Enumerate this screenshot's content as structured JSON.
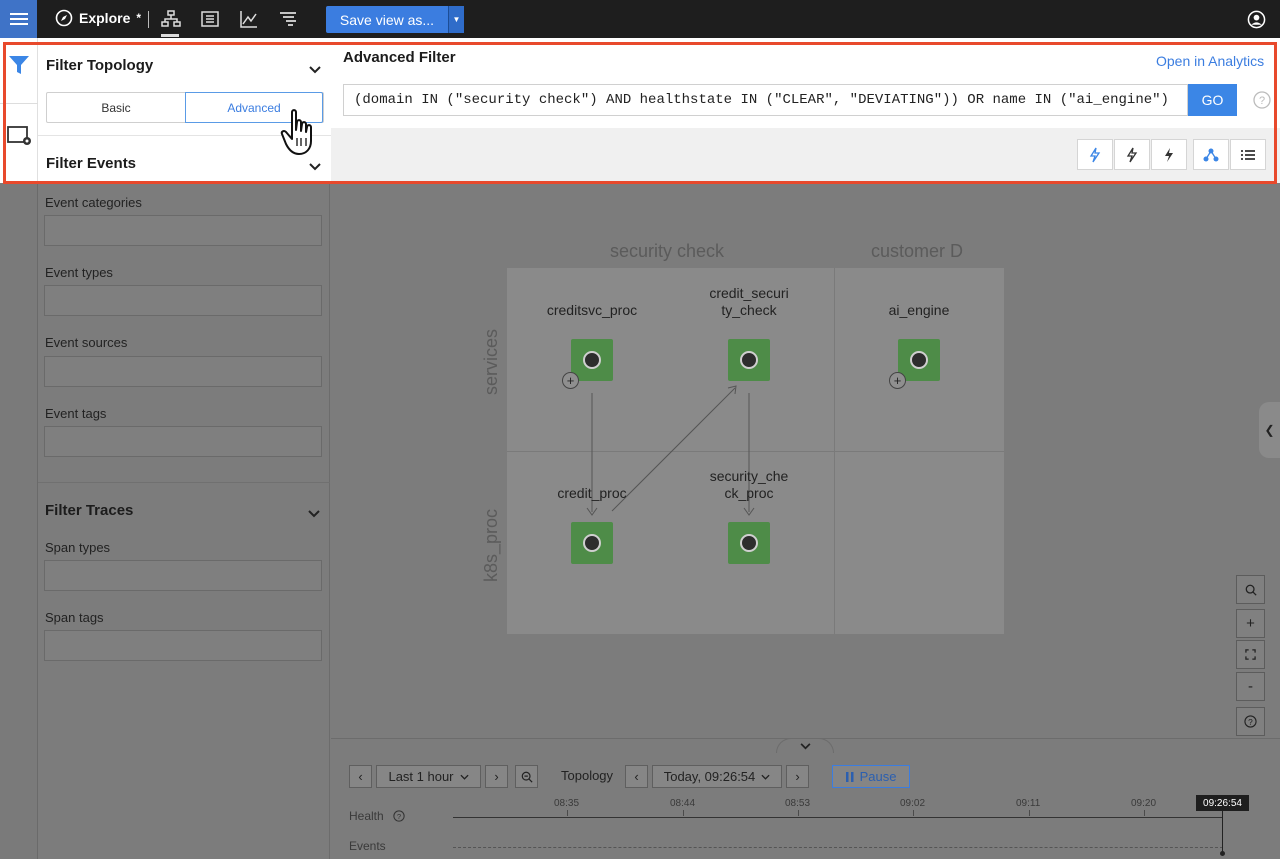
{
  "topbar": {
    "title": "Explore",
    "modified_marker": "*",
    "save_label": "Save view as..."
  },
  "left_panel": {
    "filter_topology_title": "Filter Topology",
    "mode_basic": "Basic",
    "mode_advanced": "Advanced",
    "filter_events_title": "Filter Events",
    "event_fields": [
      "Event categories",
      "Event types",
      "Event sources",
      "Event tags"
    ],
    "filter_traces_title": "Filter Traces",
    "trace_fields": [
      "Span types",
      "Span tags"
    ]
  },
  "advanced_filter": {
    "title": "Advanced Filter",
    "open_analytics": "Open in Analytics",
    "query": "(domain IN (\"security check\") AND healthstate IN (\"CLEAR\", \"DEVIATING\")) OR name IN (\"ai_engine\")",
    "go_label": "GO"
  },
  "topology": {
    "columns": [
      "security check",
      "customer D"
    ],
    "rows": [
      "services",
      "k8s_proc"
    ],
    "nodes": {
      "creditsvc_proc": "creditsvc_proc",
      "credit_security_check": "credit_securi\nty_check",
      "ai_engine": "ai_engine",
      "credit_proc": "credit_proc",
      "security_check_proc": "security_che\nck_proc"
    }
  },
  "zoom_controls": {
    "plus": "+",
    "minus": "-",
    "help": "?"
  },
  "timeline": {
    "range_label": "Last 1 hour",
    "topology_label": "Topology",
    "time_label": "Today, 09:26:54",
    "pause_label": "Pause",
    "ticks": [
      "08:35",
      "08:44",
      "08:53",
      "09:02",
      "09:11",
      "09:20"
    ],
    "now_label": "09:26:54",
    "health_label": "Health",
    "events_label": "Events"
  },
  "colors": {
    "accent": "#3b7de0",
    "highlight": "#e8492c",
    "node_green": "#4e8c48",
    "topbar": "#1e1e1e"
  }
}
